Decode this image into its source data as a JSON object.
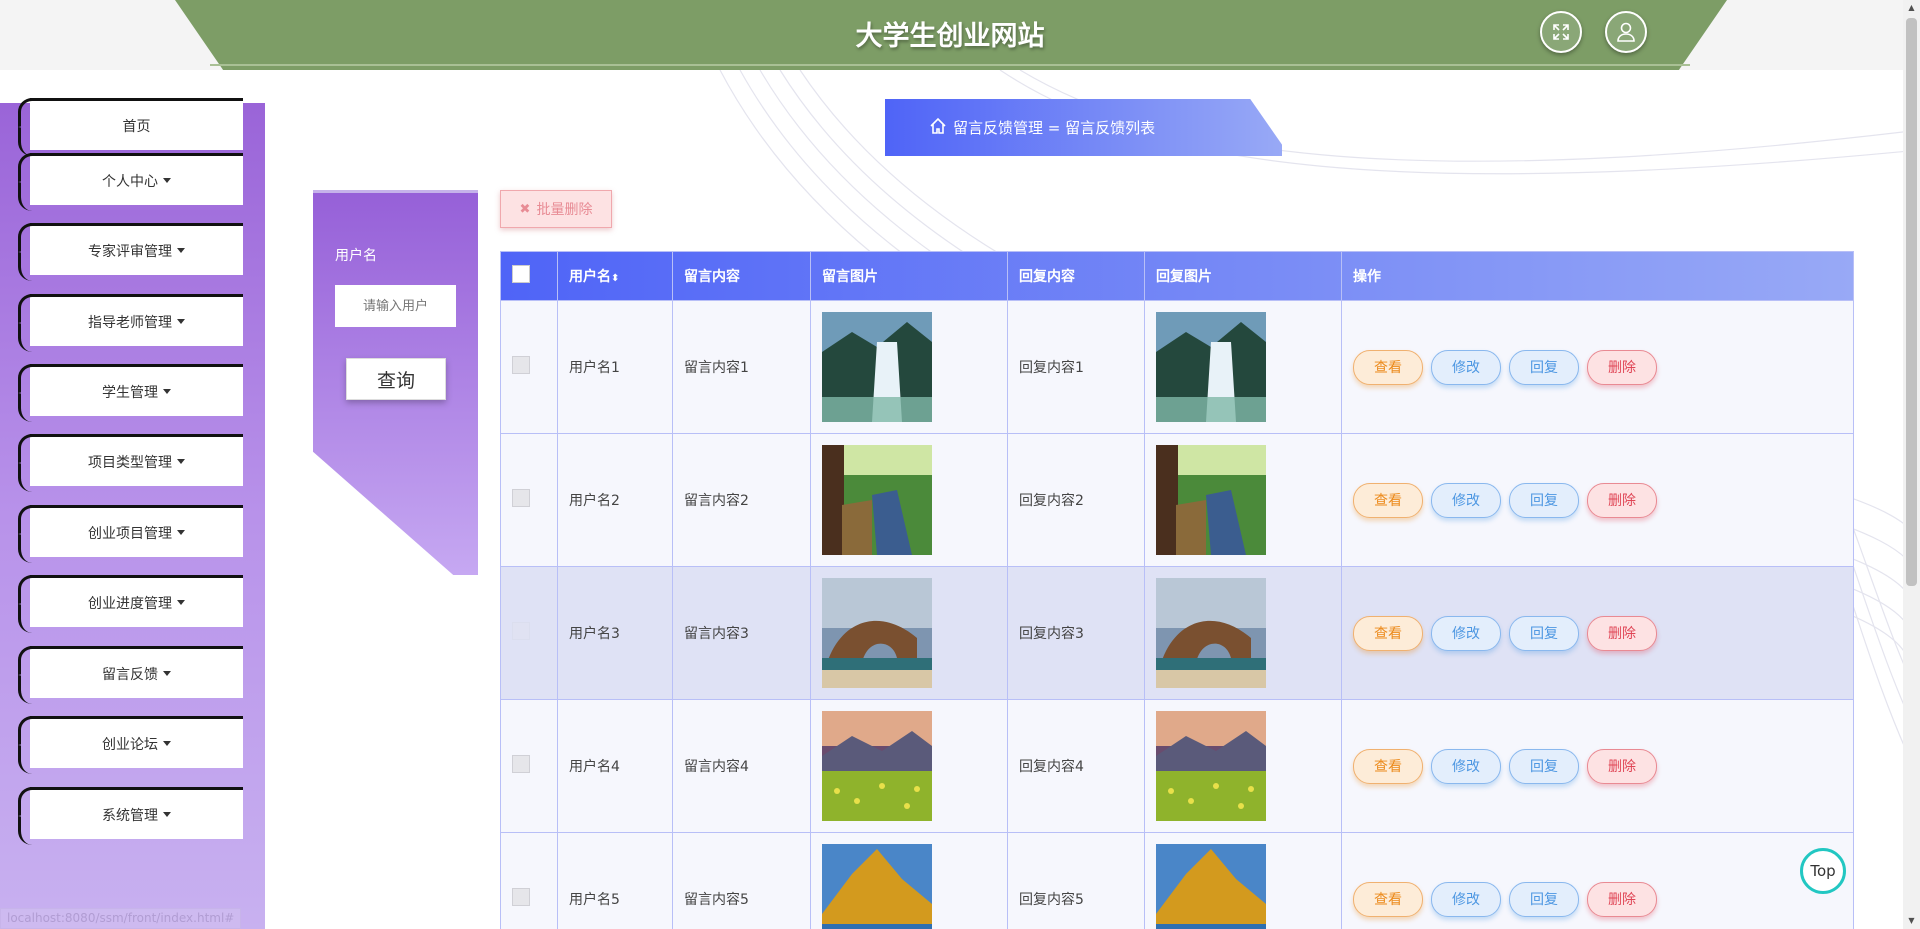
{
  "header": {
    "title": "大学生创业网站"
  },
  "sidebar": {
    "items": [
      {
        "label": "首页",
        "has_caret": false
      },
      {
        "label": "个人中心",
        "has_caret": true
      },
      {
        "label": "专家评审管理",
        "has_caret": true
      },
      {
        "label": "指导老师管理",
        "has_caret": true
      },
      {
        "label": "学生管理",
        "has_caret": true
      },
      {
        "label": "项目类型管理",
        "has_caret": true
      },
      {
        "label": "创业项目管理",
        "has_caret": true
      },
      {
        "label": "创业进度管理",
        "has_caret": true
      },
      {
        "label": "留言反馈",
        "has_caret": true
      },
      {
        "label": "创业论坛",
        "has_caret": true
      },
      {
        "label": "系统管理",
        "has_caret": true
      }
    ]
  },
  "breadcrumb": {
    "text": "留言反馈管理 = 留言反馈列表"
  },
  "search": {
    "label": "用户名",
    "placeholder": "请输入用户",
    "button": "查询"
  },
  "toolbar": {
    "batch_delete": "批量删除"
  },
  "table": {
    "columns": [
      "用户名",
      "留言内容",
      "留言图片",
      "回复内容",
      "回复图片",
      "操作"
    ],
    "rows": [
      {
        "username": "用户名1",
        "content": "留言内容1",
        "reply": "回复内容1",
        "image": "waterfall"
      },
      {
        "username": "用户名2",
        "content": "留言内容2",
        "reply": "回复内容2",
        "image": "forest-river"
      },
      {
        "username": "用户名3",
        "content": "留言内容3",
        "reply": "回复内容3",
        "image": "rock-arch"
      },
      {
        "username": "用户名4",
        "content": "留言内容4",
        "reply": "回复内容4",
        "image": "flower-meadow"
      },
      {
        "username": "用户名5",
        "content": "留言内容5",
        "reply": "回复内容5",
        "image": "golden-mountain"
      }
    ],
    "actions": {
      "view": "查看",
      "edit": "修改",
      "reply": "回复",
      "delete": "删除"
    }
  },
  "to_top": "Top",
  "status_bar": "localhost:8080/ssm/front/index.html#"
}
